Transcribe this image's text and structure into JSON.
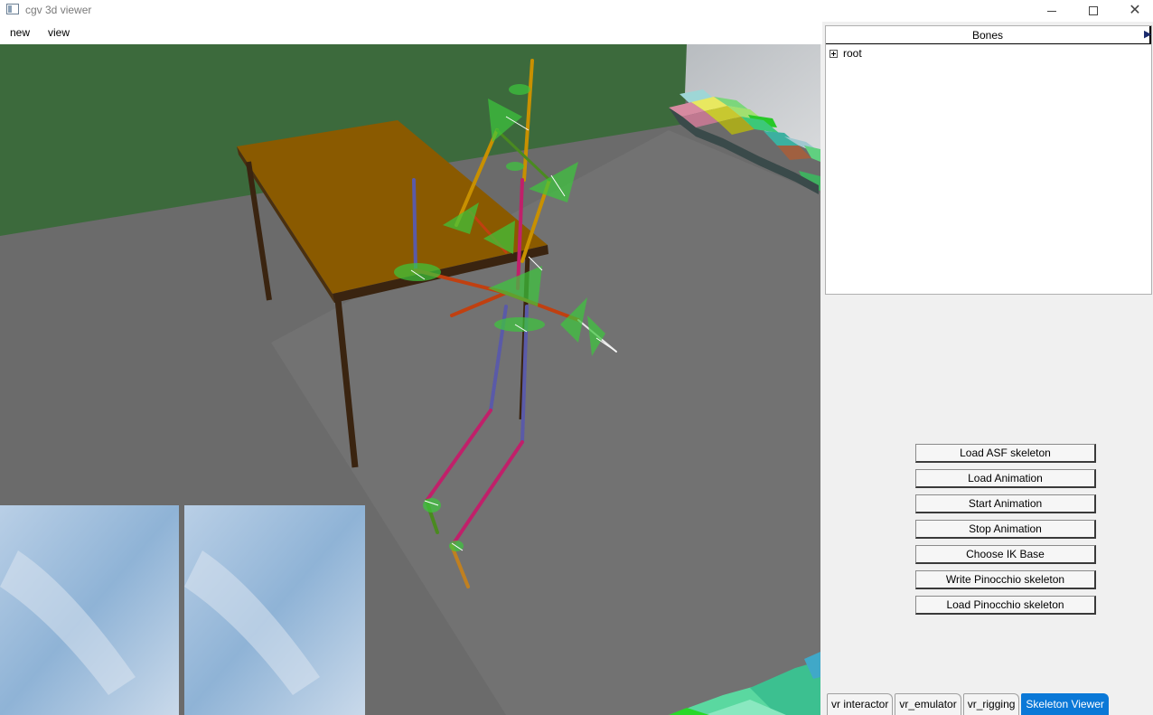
{
  "window": {
    "title": "cgv 3d viewer"
  },
  "menu": {
    "items": [
      "new",
      "view"
    ]
  },
  "bones_panel": {
    "header": "Bones",
    "root_label": "root"
  },
  "buttons": {
    "load_asf": "Load ASF skeleton",
    "load_animation": "Load Animation",
    "start_animation": "Start Animation",
    "stop_animation": "Stop Animation",
    "choose_ik_base": "Choose IK Base",
    "write_pinocchio": "Write Pinocchio skeleton",
    "load_pinocchio": "Load Pinocchio skeleton"
  },
  "tabs": [
    "vr interactor",
    "vr_emulator",
    "vr_rigging",
    "Skeleton Viewer"
  ],
  "active_tab": "Skeleton Viewer",
  "colors": {
    "accent": "#0a78d7",
    "floor": "#6b6b6b",
    "wall": "#3c6a3c",
    "table_top": "#8a5a00"
  }
}
